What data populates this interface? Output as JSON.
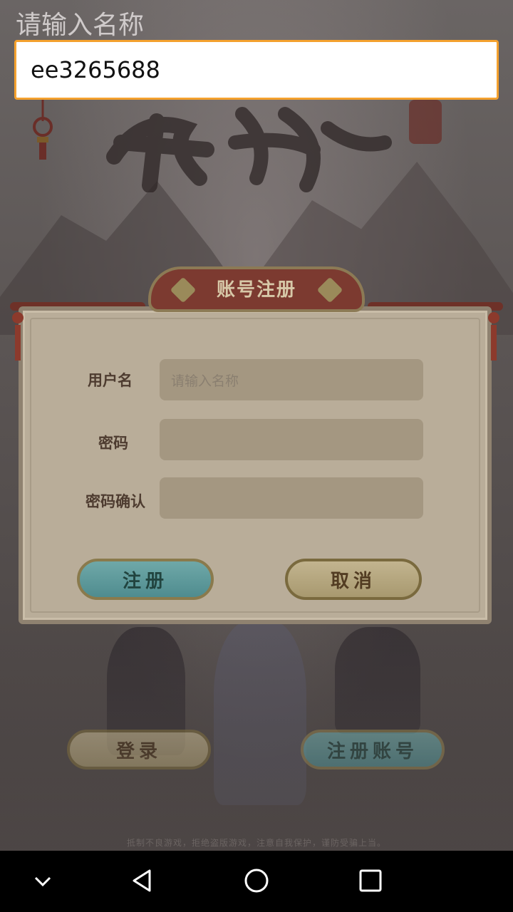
{
  "top_input": {
    "hint": "请输入名称",
    "value": "ee3265688"
  },
  "dialog": {
    "title": "账号注册",
    "fields": [
      {
        "label": "用户名",
        "placeholder": "请输入名称",
        "value": ""
      },
      {
        "label": "密码",
        "placeholder": "",
        "value": ""
      },
      {
        "label": "密码确认",
        "placeholder": "",
        "value": ""
      }
    ],
    "register_label": "注册",
    "cancel_label": "取消"
  },
  "background": {
    "login_label": "登录",
    "register_account_label": "注册账号",
    "disclaimer": "抵制不良游戏，拒绝盗版游戏，注意自我保护，谨防受骗上当。"
  },
  "navbar": {
    "icons": [
      "chevron-down-icon",
      "back-icon",
      "home-icon",
      "recents-icon"
    ]
  },
  "colors": {
    "input_focus_border": "#f4a12e",
    "dialog_bg": "#b9ad99",
    "register_button": "#5f9a9c",
    "cancel_button": "#b5a67f"
  }
}
